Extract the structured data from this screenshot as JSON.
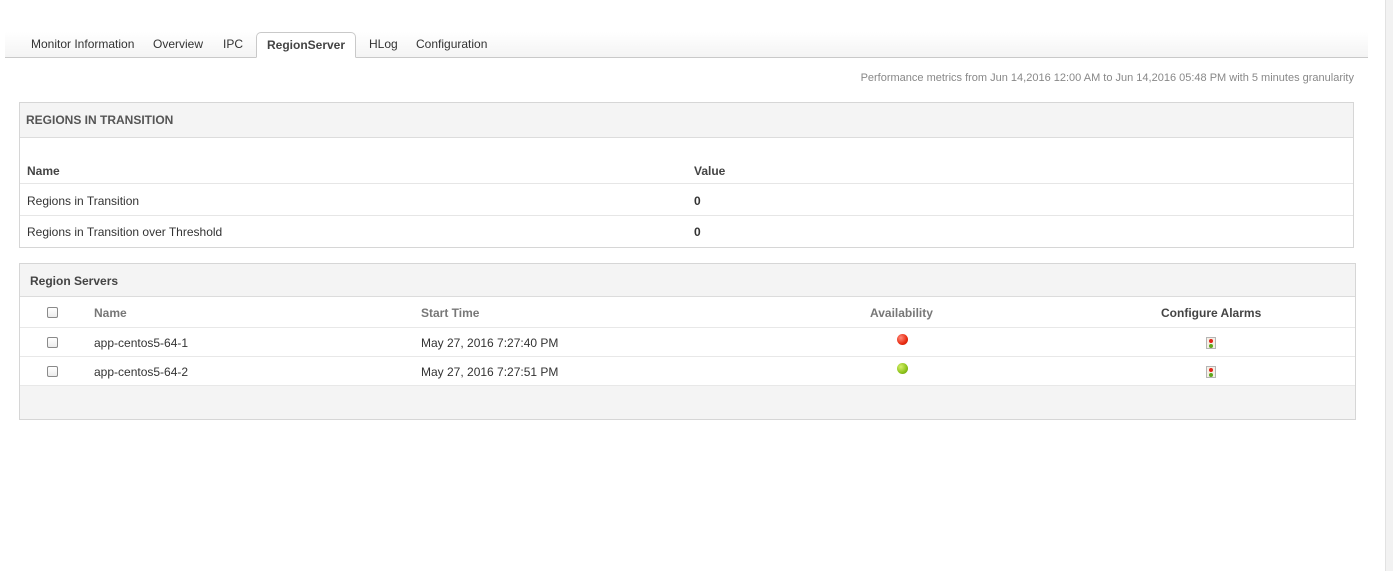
{
  "tabs": [
    {
      "label": "Monitor Information",
      "active": false
    },
    {
      "label": "Overview",
      "active": false
    },
    {
      "label": "IPC",
      "active": false
    },
    {
      "label": "RegionServer",
      "active": true
    },
    {
      "label": "HLog",
      "active": false
    },
    {
      "label": "Configuration",
      "active": false
    }
  ],
  "perf_note": "Performance metrics from Jun 14,2016 12:00 AM to Jun 14,2016 05:48 PM with 5 minutes granularity",
  "regions_in_transition": {
    "title": "REGIONS IN TRANSITION",
    "columns": [
      "Name",
      "Value"
    ],
    "rows": [
      {
        "name": "Regions in Transition",
        "value": "0"
      },
      {
        "name": "Regions in Transition over Threshold",
        "value": "0"
      }
    ]
  },
  "region_servers": {
    "title": "Region Servers",
    "columns": [
      "Name",
      "Start Time",
      "Availability",
      "Configure Alarms"
    ],
    "rows": [
      {
        "name": "app-centos5-64-1",
        "start_time": "May 27, 2016 7:27:40 PM",
        "availability": "down",
        "availability_color": "#e82a10",
        "alarm_icon": "traffic-light-icon"
      },
      {
        "name": "app-centos5-64-2",
        "start_time": "May 27, 2016 7:27:51 PM",
        "availability": "up",
        "availability_color": "#8cc21a",
        "alarm_icon": "traffic-light-icon"
      }
    ]
  }
}
